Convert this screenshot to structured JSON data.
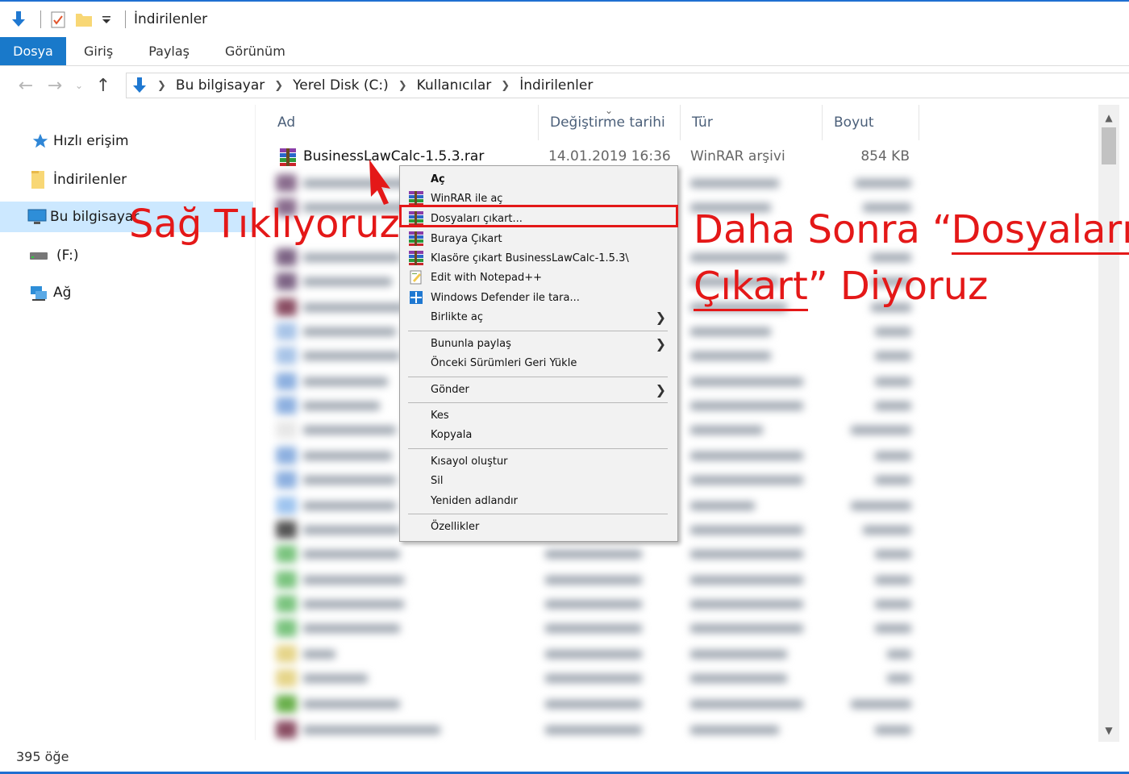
{
  "window": {
    "title": "İndirilenler"
  },
  "ribbon": {
    "tabs": [
      "Dosya",
      "Giriş",
      "Paylaş",
      "Görünüm"
    ]
  },
  "address": {
    "breadcrumbs": [
      "Bu bilgisayar",
      "Yerel Disk (C:)",
      "Kullanıcılar",
      "İndirilenler"
    ]
  },
  "nav": {
    "items": [
      {
        "label": "Hızlı erişim",
        "icon": "star-icon"
      },
      {
        "label": "İndirilenler",
        "icon": "folder-icon"
      },
      {
        "label": "Bu bilgisayar",
        "icon": "computer-icon"
      },
      {
        "label": "(F:)",
        "icon": "drive-icon"
      },
      {
        "label": "Ağ",
        "icon": "network-icon"
      }
    ]
  },
  "columns": {
    "name": "Ad",
    "date": "Değiştirme tarihi",
    "type": "Tür",
    "size": "Boyut"
  },
  "file": {
    "name": "BusinessLawCalc-1.5.3.rar",
    "date": "14.01.2019 16:36",
    "type": "WinRAR arşivi",
    "size": "854 KB"
  },
  "context_menu": {
    "items": [
      {
        "label": "Aç",
        "bold": true,
        "icon": ""
      },
      {
        "label": "WinRAR ile aç",
        "icon": "winrar-icon"
      },
      {
        "label": "Dosyaları çıkart...",
        "icon": "winrar-icon",
        "highlighted": true
      },
      {
        "label": "Buraya Çıkart",
        "icon": "winrar-icon"
      },
      {
        "label": "Klasöre çıkart BusinessLawCalc-1.5.3\\",
        "icon": "winrar-icon"
      },
      {
        "label": "Edit with Notepad++",
        "icon": "notepad-icon"
      },
      {
        "label": "Windows Defender ile tara...",
        "icon": "defender-icon"
      },
      {
        "label": "Birlikte aç",
        "submenu": true
      },
      {
        "label": "Bununla paylaş",
        "submenu": true
      },
      {
        "label": "Önceki Sürümleri Geri Yükle"
      },
      {
        "label": "Gönder",
        "submenu": true
      },
      {
        "label": "Kes"
      },
      {
        "label": "Kopyala"
      },
      {
        "label": "Kısayol oluştur"
      },
      {
        "label": "Sil"
      },
      {
        "label": "Yeniden adlandır"
      },
      {
        "label": "Özellikler"
      }
    ]
  },
  "annotations": {
    "left": "Sağ Tıklıyoruz",
    "right_prefix": "Daha Sonra “",
    "right_u1": "Dosyaları",
    "right_u2": "Çıkart",
    "right_suffix": "” Diyoruz"
  },
  "status": {
    "count": "395 öğe"
  },
  "colors": {
    "accent": "#1979ca",
    "annotation": "#e41818",
    "selection": "#cce8ff"
  }
}
